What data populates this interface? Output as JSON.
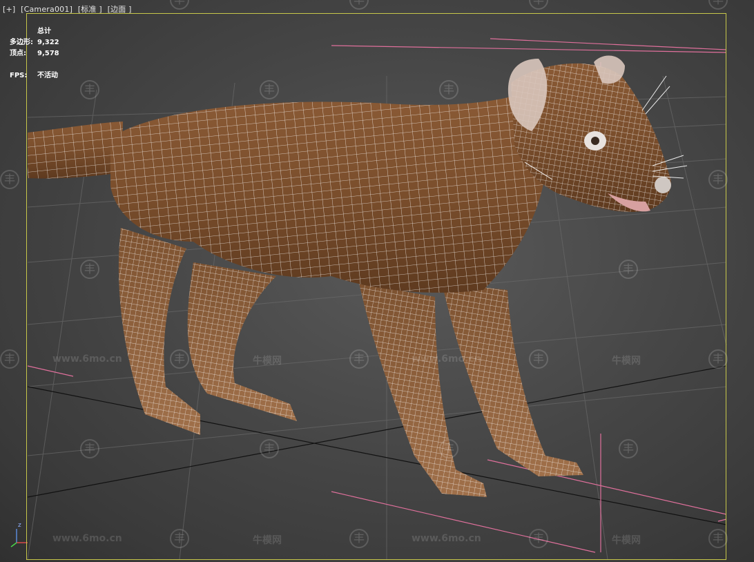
{
  "viewport": {
    "label_plus": "[+]",
    "label_camera": "[Camera001]",
    "label_shading": "[标准 ]",
    "label_edges": "[边面 ]",
    "border_color": "#c8c84a"
  },
  "stats": {
    "total_label": "总计",
    "polys_label": "多边形:",
    "polys_value": "9,322",
    "verts_label": "顶点:",
    "verts_value": "9,578",
    "fps_label": "FPS:",
    "fps_value": "不活动"
  },
  "watermark": {
    "site": "www.6mo.cn",
    "brand": "牛模网",
    "logo_glyph": "丰"
  },
  "gizmo": {
    "z_label": "z"
  },
  "icons": [
    "watermark-logo-icon",
    "axis-gizmo-icon"
  ]
}
